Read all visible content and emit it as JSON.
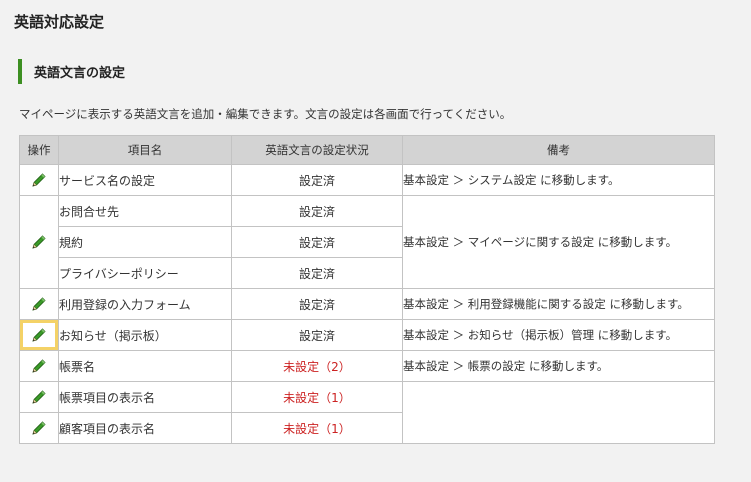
{
  "page": {
    "title": "英語対応設定"
  },
  "section": {
    "title": "英語文言の設定",
    "description": "マイページに表示する英語文言を追加・編集できます。文言の設定は各画面で行ってください。"
  },
  "colors": {
    "accent": "#3d8f22",
    "unset": "#cc2222",
    "highlight": "#f4d266",
    "pencil": "#3a9a28"
  },
  "table": {
    "headers": {
      "op": "操作",
      "item": "項目名",
      "status": "英語文言の設定状況",
      "note": "備考"
    },
    "rows": [
      {
        "item": "サービス名の設定",
        "status": "設定済",
        "note": "基本設定 ＞ システム設定 に移動します。"
      },
      {
        "item": "お問合せ先",
        "status": "設定済",
        "note": "基本設定 ＞ マイページに関する設定 に移動します。"
      },
      {
        "item": "規約",
        "status": "設定済"
      },
      {
        "item": "プライバシーポリシー",
        "status": "設定済"
      },
      {
        "item": "利用登録の入力フォーム",
        "status": "設定済",
        "note": "基本設定 ＞ 利用登録機能に関する設定 に移動します。"
      },
      {
        "item": "お知らせ（掲示板）",
        "status": "設定済",
        "note": "基本設定 ＞ お知らせ（掲示板）管理 に移動します。"
      },
      {
        "item": "帳票名",
        "status": "未設定（2）",
        "note": "基本設定 ＞ 帳票の設定 に移動します。"
      },
      {
        "item": "帳票項目の表示名",
        "status": "未設定（1）",
        "note": ""
      },
      {
        "item": "顧客項目の表示名",
        "status": "未設定（1）",
        "note": ""
      }
    ],
    "edit_icon": "pencil-icon"
  }
}
